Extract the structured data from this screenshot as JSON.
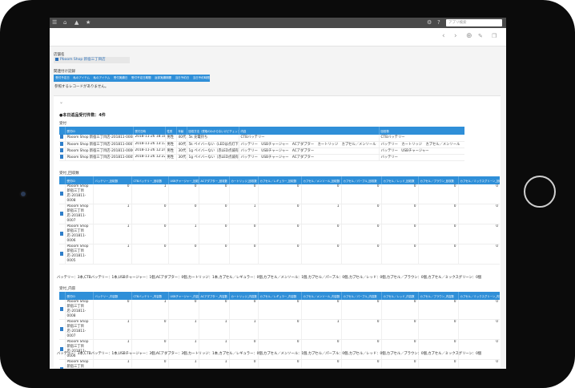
{
  "topbar": {
    "icons": [
      "menu-icon",
      "home-icon",
      "bell-icon",
      "star-icon"
    ],
    "right_icons": [
      "gear-icon",
      "help-icon"
    ],
    "search_placeholder": "アプリ検索"
  },
  "toolbar": {
    "icons": [
      "chevron-left-icon",
      "chevron-right-icon",
      "plus-icon",
      "edit-icon",
      "copy-icon"
    ]
  },
  "store": {
    "label": "店舗名",
    "name": "Pboom Shop 新宿三丁目店"
  },
  "related": {
    "label": "関連付け記録",
    "tabs": [
      "受付予定日",
      "私のアイテム",
      "私のアイテム",
      "受付実績日",
      "受付予定日期間",
      "返却実績期間",
      "当日予約日",
      "当日予約時間"
    ],
    "empty": "参照するレコードがありません。"
  },
  "section_heading": "●本日返品受付件数：4件",
  "table1": {
    "label": "受付",
    "headers": [
      "受付ID",
      "受付日時",
      "性別",
      "年齢",
      "回収方法（受取のわからないけどチェックする）",
      "内容",
      "回収物"
    ],
    "rows": [
      [
        "Pboom Shop 新宿三丁目店-201811-0008",
        "2018-11-26 18:18",
        "男性",
        "40代",
        "5k 充電持ち",
        "CTBバッテリー",
        "CTBバッテリー"
      ],
      [
        "Pboom Shop 新宿三丁目店-201811-0007",
        "2018-11-26 13:13",
        "男性",
        "40代",
        "5k ペイバーない（LEDは点灯下）",
        "バッテリー　USBチャージャー　ACアダプター　カートリッジ　カプセル／メンソール",
        "バッテリー　カートリッジ　カプセル／メンソール"
      ],
      [
        "Pboom Shop 新宿三丁目店-201811-0006",
        "2018-11-26 12:24",
        "男性",
        "30代",
        "1g ペイバーない（赤LED点滅有）",
        "バッテリー　USBチャージャー　ACアダプター",
        "バッテリー　USBチャージャー"
      ],
      [
        "Pboom Shop 新宿三丁目店-201811-0005",
        "2018-11-26 12:22",
        "男性",
        "30代",
        "1g ペイバーない（赤LED点滅有）",
        "バッテリー　USBチャージャー　ACアダプター",
        "バッテリー"
      ]
    ]
  },
  "table2": {
    "label": "受付_回収数",
    "headers": [
      "受付ID",
      "バッテリー_回収数",
      "CTBバッテリー_回収数",
      "USBチャージャー_回収数",
      "ACアダプター_回収数",
      "カートリッジ_回収数",
      "カプセル／レギュラー_回収数",
      "カプセル／メンソール_回収数",
      "カプセル／パープル_回収数",
      "カプセル／レッド_回収数",
      "カプセル／ブラウン_回収数",
      "カプセル／ミックスグリーン_回収数"
    ],
    "rows": [
      [
        "Pboom Shop 新宿三丁目店-201811-0008",
        "0",
        "1",
        "0",
        "0",
        "0",
        "0",
        "0",
        "0",
        "0",
        "0",
        "0"
      ],
      [
        "Pboom Shop 新宿三丁目店-201811-0007",
        "1",
        "0",
        "0",
        "0",
        "1",
        "0",
        "1",
        "0",
        "0",
        "0",
        "0"
      ],
      [
        "Pboom Shop 新宿三丁目店-201811-0006",
        "1",
        "0",
        "1",
        "0",
        "0",
        "0",
        "0",
        "0",
        "0",
        "0",
        "0"
      ],
      [
        "Pboom Shop 新宿三丁目店-201811-0005",
        "1",
        "0",
        "0",
        "0",
        "0",
        "0",
        "0",
        "0",
        "0",
        "0",
        "0"
      ]
    ],
    "summary": "バッテリー：3本,CTBバッテリー：1本,USBチャージャー：1個,ACアダプター：0個,カートリッジ：1本,カプセル／レギュラー：0個,カプセル／メンソール：1個,カプセル／パープル：0個,カプセル／レッド：0個,カプセル／ブラウン：0個,カプセル／ミックスグリーン：0個"
  },
  "table3": {
    "label": "受付_内容",
    "headers": [
      "受付ID",
      "バッテリー_内容数",
      "CTBバッテリー_内容数",
      "USBチャージャー_内容数",
      "ACアダプター_内容数",
      "カートリッジ_内容数",
      "カプセル／レギュラー_内容数",
      "カプセル／メンソール_内容数",
      "カプセル／パープル_内容数",
      "カプセル／レッド_内容数",
      "カプセル／ブラウン_内容数",
      "カプセル／ミックスグリーン_内容数"
    ],
    "rows": [
      [
        "Pboom Shop 新宿三丁目店-201811-0008",
        "0",
        "1",
        "0",
        "0",
        "0",
        "0",
        "0",
        "0",
        "0",
        "0",
        "0"
      ],
      [
        "Pboom Shop 新宿三丁目店-201811-0007",
        "1",
        "0",
        "1",
        "1",
        "1",
        "0",
        "1",
        "0",
        "0",
        "0",
        "0"
      ],
      [
        "Pboom Shop 新宿三丁目店-201811-0006",
        "1",
        "0",
        "1",
        "1",
        "0",
        "0",
        "0",
        "0",
        "0",
        "0",
        "0"
      ],
      [
        "Pboom Shop 新宿三丁目店-201811-0005",
        "1",
        "0",
        "1",
        "1",
        "0",
        "0",
        "0",
        "0",
        "0",
        "0",
        "0"
      ]
    ],
    "summary": "バッテリー：3本,CTBバッテリー：1本,USBチャージャー：3個,ACアダプター：3個,カートリッジ：1本,カプセル／レギュラー：0個,カプセル／メンソール：1個,カプセル／パープル：0個,カプセル／レッド：0個,カプセル／ブラウン：0個,カプセル／ミックスグリーン：0個"
  }
}
